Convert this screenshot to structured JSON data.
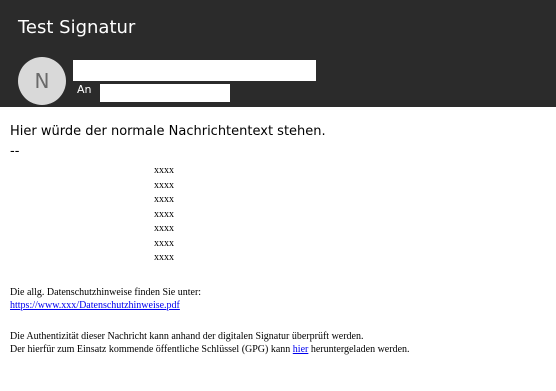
{
  "header": {
    "subject": "Test Signatur",
    "avatar_initial": "N",
    "to_label": "An"
  },
  "body": {
    "text": "Hier würde der normale Nachrichtentext stehen.",
    "separator": "--",
    "signature_lines": [
      "xxxx",
      "xxxx",
      "xxxx",
      "xxxx",
      "xxxx",
      "xxxx",
      "xxxx"
    ],
    "privacy_text": "Die allg. Datenschutzhinweise finden Sie unter:",
    "privacy_link": "https://www.xxx/Datenschutzhinweise.pdf",
    "auth_line1": "Die Authentizität dieser Nachricht kann anhand der digitalen Signatur überprüft werden.",
    "auth_line2_before": "Der hierfür zum Einsatz kommende öffentliche Schlüssel (GPG) kann ",
    "auth_link": "hier",
    "auth_line2_after": " heruntergeladen werden."
  }
}
